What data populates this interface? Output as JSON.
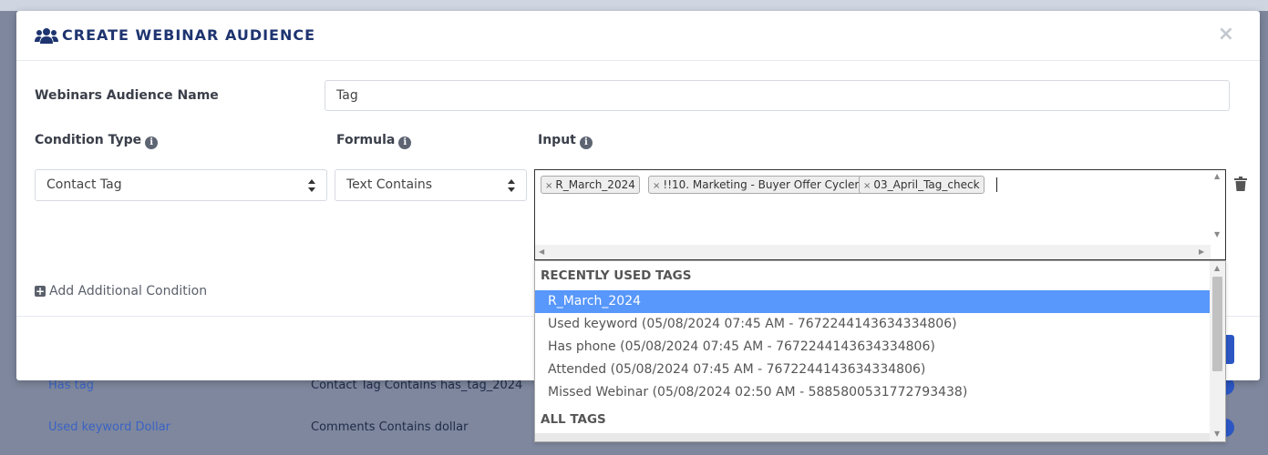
{
  "modal": {
    "title": "CREATE WEBINAR AUDIENCE",
    "close": "×"
  },
  "audience_name": {
    "label": "Webinars Audience Name",
    "value": "Tag"
  },
  "condition": {
    "type_label": "Condition Type",
    "formula_label": "Formula",
    "input_label": "Input",
    "info_glyph": "i",
    "type_value": "Contact Tag",
    "formula_value": "Text Contains",
    "tags": [
      {
        "label": "R_March_2024",
        "remove": "×"
      },
      {
        "label": "!!10. Marketing - Buyer Offer Cycler",
        "remove": "×"
      },
      {
        "label": "03_April_Tag_check",
        "remove": "×"
      }
    ]
  },
  "add_condition": {
    "plus": "+",
    "label": "Add Additional Condition"
  },
  "dropdown": {
    "recent_group": "RECENTLY USED TAGS",
    "recent_items": [
      "R_March_2024",
      "Used keyword (05/08/2024 07:45 AM - 7672244143634334806)",
      "Has phone (05/08/2024 07:45 AM - 7672244143634334806)",
      "Attended (05/08/2024 07:45 AM - 7672244143634334806)",
      "Missed Webinar (05/08/2024 02:50 AM - 5885800531772793438)"
    ],
    "all_group": "ALL TAGS"
  },
  "background": {
    "rows": [
      {
        "name": "Has tag",
        "desc": "Contact Tag Contains has_tag_2024"
      },
      {
        "name": "Used keyword Dollar",
        "desc": "Comments Contains dollar"
      }
    ]
  },
  "colors": {
    "title": "#1e3470",
    "highlight": "#5897fb",
    "accent": "#2b56c4"
  },
  "icons": {
    "header": "users-icon",
    "info": "info-circle-icon",
    "select_arrows": "sort-arrows-icon",
    "delete": "trash-icon",
    "add": "plus-square-icon",
    "close": "close-icon"
  }
}
